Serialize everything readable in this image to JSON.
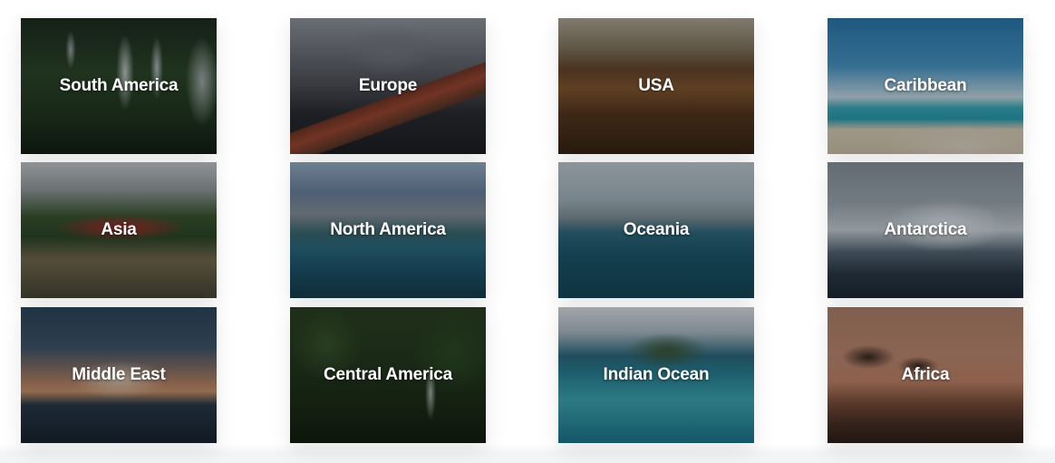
{
  "destinations": [
    {
      "label": "South America"
    },
    {
      "label": "Europe"
    },
    {
      "label": "USA"
    },
    {
      "label": "Caribbean"
    },
    {
      "label": "Asia"
    },
    {
      "label": "North America"
    },
    {
      "label": "Oceania"
    },
    {
      "label": "Antarctica"
    },
    {
      "label": "Middle East"
    },
    {
      "label": "Central America"
    },
    {
      "label": "Indian Ocean"
    },
    {
      "label": "Africa"
    }
  ]
}
